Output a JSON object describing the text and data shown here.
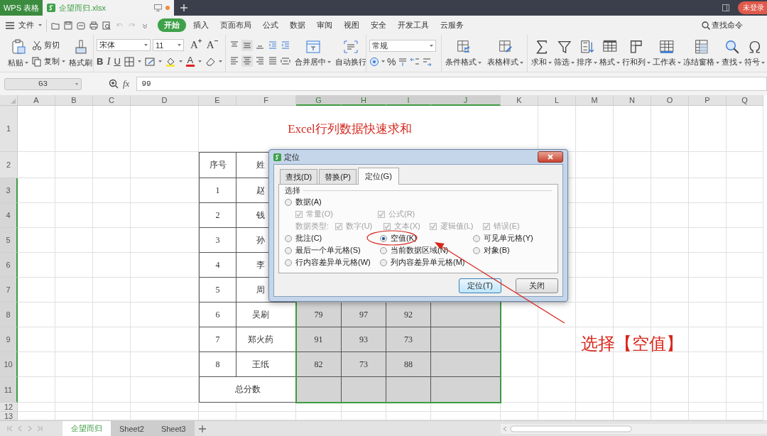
{
  "title_bar": {
    "app_tab": "WPS 表格",
    "doc_tab": "企望而归.xlsx",
    "login_badge": "未登录"
  },
  "menu_bar": {
    "file": "文件",
    "tabs": [
      {
        "label": "开始",
        "selected": true
      },
      {
        "label": "插入",
        "selected": false
      },
      {
        "label": "页面布局",
        "selected": false
      },
      {
        "label": "公式",
        "selected": false
      },
      {
        "label": "数据",
        "selected": false
      },
      {
        "label": "审阅",
        "selected": false
      },
      {
        "label": "视图",
        "selected": false
      },
      {
        "label": "安全",
        "selected": false
      },
      {
        "label": "开发工具",
        "selected": false
      },
      {
        "label": "云服务",
        "selected": false
      }
    ],
    "search_command": "查找命令"
  },
  "ribbon": {
    "paste": "粘贴",
    "cut": "剪切",
    "copy": "复制",
    "format_painter": "格式刷",
    "font_name": "宋体",
    "font_size": "11",
    "grow_font": "A",
    "shrink_font": "A",
    "bold": "B",
    "italic": "I",
    "underline": "U",
    "font_color": "A",
    "merge_center": "合并居中",
    "wrap_text": "自动换行",
    "number_format": "常规",
    "percent": "%",
    "tools": [
      {
        "label": "条件格式"
      },
      {
        "label": "表格样式"
      },
      {
        "label": "求和"
      },
      {
        "label": "筛选"
      },
      {
        "label": "排序"
      },
      {
        "label": "格式"
      },
      {
        "label": "行和列"
      },
      {
        "label": "工作表"
      },
      {
        "label": "冻结窗格"
      },
      {
        "label": "查找"
      },
      {
        "label": "符号"
      }
    ]
  },
  "formula_bar": {
    "name_box": "G3",
    "fx": "fx",
    "value": "99"
  },
  "sheet": {
    "columns": [
      {
        "label": "A",
        "selected": false
      },
      {
        "label": "B",
        "selected": false
      },
      {
        "label": "C",
        "selected": false
      },
      {
        "label": "D",
        "selected": false
      },
      {
        "label": "E",
        "selected": false
      },
      {
        "label": "F",
        "selected": false
      },
      {
        "label": "G",
        "selected": true
      },
      {
        "label": "H",
        "selected": true
      },
      {
        "label": "I",
        "selected": true
      },
      {
        "label": "J",
        "selected": true
      },
      {
        "label": "K",
        "selected": false
      },
      {
        "label": "L",
        "selected": false
      },
      {
        "label": "M",
        "selected": false
      },
      {
        "label": "N",
        "selected": false
      },
      {
        "label": "O",
        "selected": false
      },
      {
        "label": "P",
        "selected": false
      },
      {
        "label": "Q",
        "selected": false
      }
    ],
    "rows": [
      {
        "label": "1",
        "selected": false
      },
      {
        "label": "2",
        "selected": false
      },
      {
        "label": "3",
        "selected": true
      },
      {
        "label": "4",
        "selected": true
      },
      {
        "label": "5",
        "selected": true
      },
      {
        "label": "6",
        "selected": true
      },
      {
        "label": "7",
        "selected": true
      },
      {
        "label": "8",
        "selected": true
      },
      {
        "label": "9",
        "selected": true
      },
      {
        "label": "10",
        "selected": true
      },
      {
        "label": "11",
        "selected": true
      },
      {
        "label": "12",
        "selected": false
      },
      {
        "label": "13",
        "selected": false
      }
    ],
    "title": "Excel行列数据快速求和",
    "table": [
      [
        {
          "text": "序号",
          "selected": false
        },
        {
          "text": "姓",
          "selected": false
        }
      ],
      [
        {
          "text": "1",
          "selected": false
        },
        {
          "text": "赵",
          "selected": false
        }
      ],
      [
        {
          "text": "2",
          "selected": false
        },
        {
          "text": "钱",
          "selected": false
        }
      ],
      [
        {
          "text": "3",
          "selected": false
        },
        {
          "text": "孙",
          "selected": false
        }
      ],
      [
        {
          "text": "4",
          "selected": false
        },
        {
          "text": "李",
          "selected": false
        }
      ],
      [
        {
          "text": "5",
          "selected": false
        },
        {
          "text": "周",
          "selected": false
        }
      ],
      [
        {
          "text": "6",
          "selected": false
        },
        {
          "text": "吴刷",
          "selected": false
        },
        {
          "text": "79",
          "selected": true
        },
        {
          "text": "97",
          "selected": true
        },
        {
          "text": "92",
          "selected": true
        },
        {
          "selected": true
        }
      ],
      [
        {
          "text": "7",
          "selected": false
        },
        {
          "text": "郑火药",
          "selected": false
        },
        {
          "text": "91",
          "selected": true
        },
        {
          "text": "93",
          "selected": true
        },
        {
          "text": "73",
          "selected": true
        },
        {
          "selected": true
        }
      ],
      [
        {
          "text": "8",
          "selected": false
        },
        {
          "text": "王纸",
          "selected": false
        },
        {
          "text": "82",
          "selected": true
        },
        {
          "text": "73",
          "selected": true
        },
        {
          "text": "88",
          "selected": true
        },
        {
          "selected": true
        }
      ]
    ],
    "total_row": {
      "label": "总分数",
      "cells": [
        {
          "selected": true
        },
        {
          "selected": true
        },
        {
          "selected": true
        },
        {
          "selected": true
        }
      ]
    }
  },
  "sheet_tabs": [
    {
      "label": "企望而归",
      "selected": true
    },
    {
      "label": "Sheet2",
      "selected": false
    },
    {
      "label": "Sheet3",
      "selected": false
    }
  ],
  "dialog": {
    "title": "定位",
    "tabs": [
      {
        "label": "查找(D)",
        "selected": false
      },
      {
        "label": "替换(P)",
        "selected": false
      },
      {
        "label": "定位(G)",
        "selected": true
      }
    ],
    "group": "选择",
    "options": [
      {
        "kind": "radio",
        "label": "数据(A)",
        "selected": false
      },
      {
        "kind": "checkbox",
        "label": "常量(O)",
        "checked": true,
        "disabled": true
      },
      {
        "kind": "checkbox",
        "label": "公式(R)",
        "checked": true,
        "disabled": true
      },
      {
        "kind": "label",
        "label": "数据类型:"
      },
      {
        "kind": "checkbox",
        "label": "数字(U)",
        "checked": true,
        "disabled": true
      },
      {
        "kind": "checkbox",
        "label": "文本(X)",
        "checked": true,
        "disabled": true
      },
      {
        "kind": "checkbox",
        "label": "逻辑值(L)",
        "checked": true,
        "disabled": true
      },
      {
        "kind": "checkbox",
        "label": "错误(E)",
        "checked": true,
        "disabled": true
      },
      {
        "kind": "radio",
        "label": "批注(C)",
        "selected": false
      },
      {
        "kind": "radio",
        "label": "空值(K)",
        "selected": true
      },
      {
        "kind": "radio",
        "label": "可见单元格(Y)",
        "selected": false
      },
      {
        "kind": "radio",
        "label": "最后一个单元格(S)",
        "selected": false
      },
      {
        "kind": "radio",
        "label": "当前数据区域(N)",
        "selected": false
      },
      {
        "kind": "radio",
        "label": "对象(B)",
        "selected": false
      },
      {
        "kind": "radio",
        "label": "行内容差异单元格(W)",
        "selected": false
      },
      {
        "kind": "radio",
        "label": "列内容差异单元格(M)",
        "selected": false
      }
    ],
    "buttons": [
      {
        "label": "定位(T)",
        "default": true
      },
      {
        "label": "关闭",
        "default": false
      }
    ]
  },
  "annotation": {
    "callout": "选择【空值】"
  }
}
